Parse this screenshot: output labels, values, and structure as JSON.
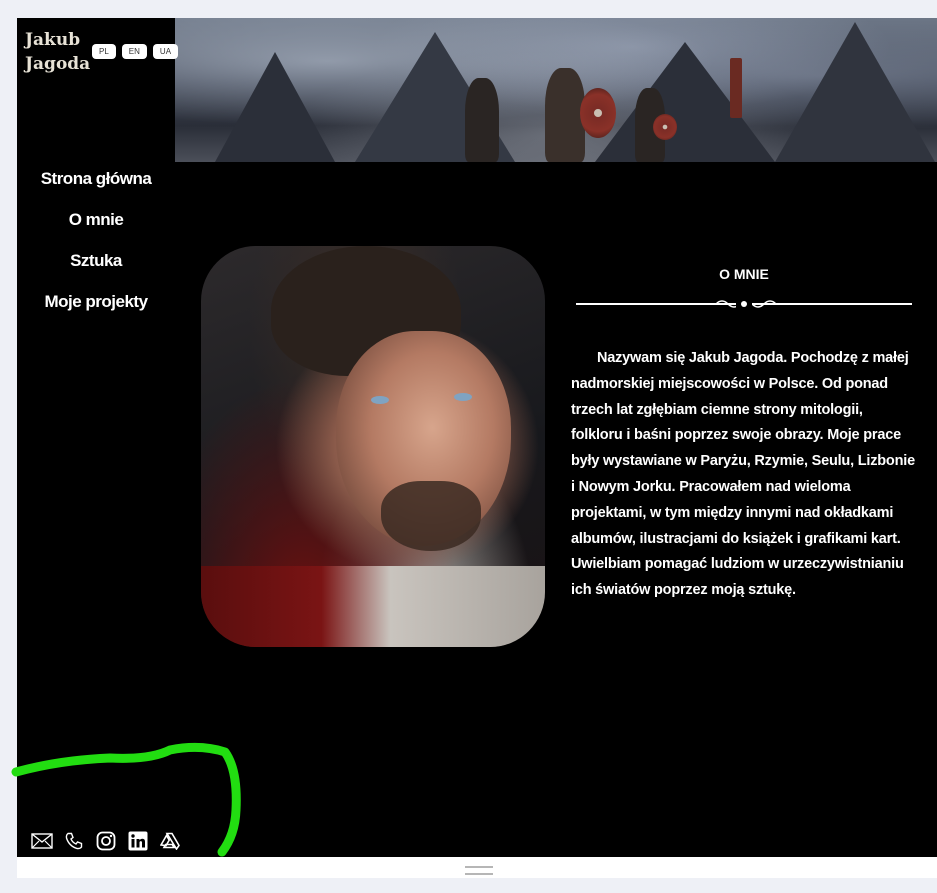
{
  "brand": {
    "line1": "Jakub",
    "line2": "Jagoda"
  },
  "languages": [
    "PL",
    "EN",
    "UA"
  ],
  "nav": [
    "Strona główna",
    "O mnie",
    "Sztuka",
    "Moje projekty"
  ],
  "about": {
    "heading": "O MNIE",
    "text": "Nazywam się Jakub Jagoda. Pochodzę z małej nadmorskiej miejscowości w Polsce. Od ponad trzech lat zgłębiam ciemne strony mitologii, folkloru i baśni poprzez swoje obrazy. Moje prace były wystawiane w Paryżu, Rzymie, Seulu, Lizbonie i Nowym Jorku. Pracowałem nad wieloma projektami, w tym między innymi nad okładkami albumów, ilustracjami do książek i grafikami kart. Uwielbiam pomagać ludziom w urzeczywistnianiu ich światów poprzez moją sztukę."
  },
  "social_icons": [
    "mail-icon",
    "phone-icon",
    "instagram-icon",
    "linkedin-icon",
    "artstation-icon"
  ],
  "colors": {
    "background": "#000000",
    "text": "#ffffff",
    "annotation": "#22dd11",
    "page": "#eef0f6"
  }
}
